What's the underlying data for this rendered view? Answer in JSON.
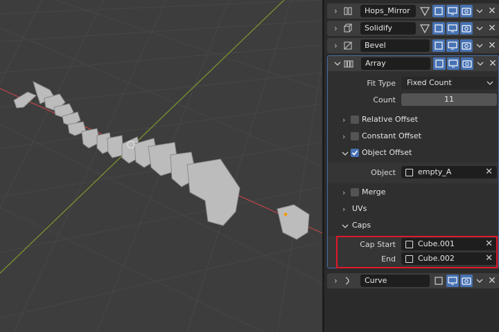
{
  "modifiers": [
    {
      "name": "Hops_Mirror",
      "icon": "mirror-modifier-icon"
    },
    {
      "name": "Solidify",
      "icon": "solidify-modifier-icon"
    },
    {
      "name": "Bevel",
      "icon": "bevel-modifier-icon"
    },
    {
      "name": "Array",
      "icon": "array-modifier-icon"
    },
    {
      "name": "Curve",
      "icon": "curve-modifier-icon"
    }
  ],
  "array": {
    "fit_type_label": "Fit Type",
    "fit_type_value": "Fixed Count",
    "count_label": "Count",
    "count_value": "11",
    "relative_offset": {
      "label": "Relative Offset",
      "checked": false
    },
    "constant_offset": {
      "label": "Constant Offset",
      "checked": false
    },
    "object_offset": {
      "label": "Object Offset",
      "checked": true
    },
    "object_label": "Object",
    "object_value": "empty_A",
    "merge": {
      "label": "Merge",
      "checked": false
    },
    "uvs_label": "UVs",
    "caps_label": "Caps",
    "cap_start_label": "Cap Start",
    "cap_start_value": "Cube.001",
    "cap_end_label": "End",
    "cap_end_value": "Cube.002"
  },
  "colors": {
    "accent": "#4772b3",
    "highlight": "#e2182c",
    "x_axis": "#c0454b",
    "y_axis": "#7f9b2f"
  }
}
